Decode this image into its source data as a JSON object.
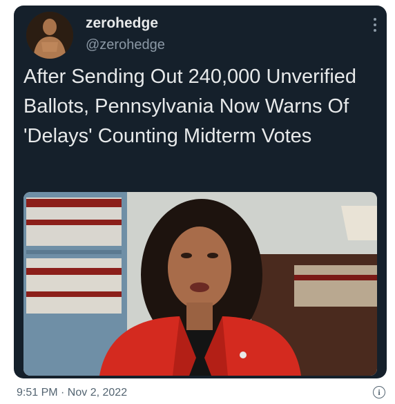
{
  "tweet": {
    "display_name": "zerohedge",
    "handle": "@zerohedge",
    "headline": "After Sending Out 240,000 Unverified Ballots, Pennsylvania Now Warns Of 'Delays' Counting Midterm Votes",
    "timestamp": "9:51 PM · Nov 2, 2022"
  },
  "icons": {
    "more": "more-vertical-icon",
    "info": "info-icon"
  },
  "colors": {
    "card_background": "#15202b",
    "primary_text": "#e7e9ea",
    "secondary_text": "#8b98a5",
    "jacket": "#d42a1f"
  }
}
